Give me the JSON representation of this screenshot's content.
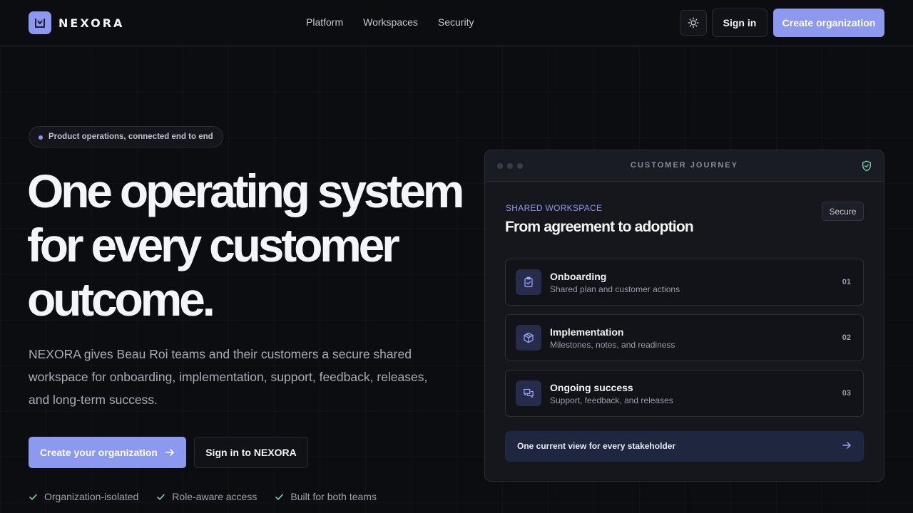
{
  "brand": {
    "name": "NEXORA",
    "logo_icon": "logo-icon"
  },
  "nav": {
    "items": [
      {
        "label": "Platform"
      },
      {
        "label": "Workspaces"
      },
      {
        "label": "Security"
      }
    ]
  },
  "header": {
    "theme_icon": "sun-icon",
    "sign_in_label": "Sign in",
    "create_label": "Create organization"
  },
  "hero": {
    "badge": "Product operations, connected end to end",
    "title_lines": [
      "One operating system",
      "for every customer",
      "outcome."
    ],
    "subtitle": "NEXORA gives Beau Roi teams and their customers a secure shared workspace for onboarding, implementation, support, feedback, releases, and long-term success.",
    "primary_cta": "Create your organization",
    "secondary_cta": "Sign in to NEXORA",
    "checks": [
      {
        "label": "Organization-isolated"
      },
      {
        "label": "Role-aware access"
      },
      {
        "label": "Built for both teams"
      }
    ]
  },
  "card": {
    "window_title": "CUSTOMER JOURNEY",
    "kicker": "SHARED WORKSPACE",
    "title": "From agreement to adoption",
    "badge": "Secure",
    "steps": [
      {
        "title": "Onboarding",
        "desc": "Shared plan and customer actions",
        "num": "01",
        "icon": "clipboard-check-icon"
      },
      {
        "title": "Implementation",
        "desc": "Milestones, notes, and readiness",
        "num": "02",
        "icon": "package-icon"
      },
      {
        "title": "Ongoing success",
        "desc": "Support, feedback, and releases",
        "num": "03",
        "icon": "chat-icon"
      }
    ],
    "footer": "One current view for every stakeholder"
  },
  "colors": {
    "accent": "#8d98ef",
    "background": "#0c0d11",
    "card": "#15171d",
    "check": "#7fd1a6"
  }
}
